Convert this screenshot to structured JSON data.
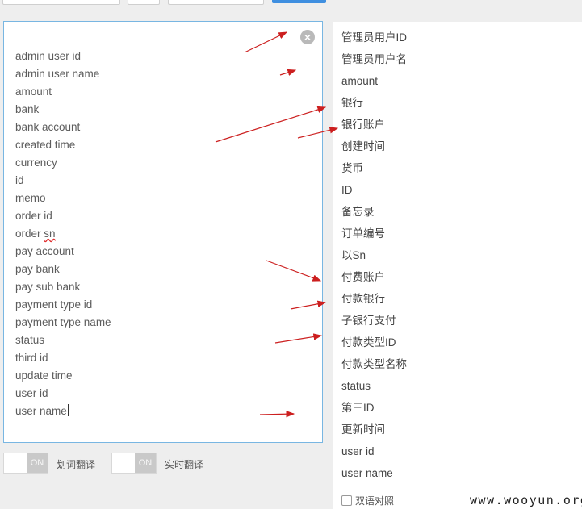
{
  "source": {
    "items": [
      "admin user id",
      "admin user name",
      "amount",
      "bank",
      "bank account",
      "created time",
      "currency",
      "id",
      "memo",
      "order id",
      "order ",
      "sn",
      "pay account",
      "pay bank",
      "pay sub bank",
      "payment type id",
      "payment type name",
      "status",
      "third id",
      "update time",
      "user id",
      "user name"
    ],
    "clear_icon": "×"
  },
  "toggles": [
    {
      "state": "ON",
      "label": "划词翻译"
    },
    {
      "state": "ON",
      "label": "实时翻译"
    }
  ],
  "results": [
    "管理员用户ID",
    "管理员用户名",
    "amount",
    "银行",
    "银行账户",
    "创建时间",
    "货币",
    "ID",
    "备忘录",
    "订单编号",
    "以Sn",
    "付费账户",
    "付款银行",
    "子银行支付",
    "付款类型ID",
    "付款类型名称",
    "status",
    "第三ID",
    "更新时间",
    "user id",
    "user name"
  ],
  "bilingual_label": "双语对照",
  "watermark": "www.wooyun.org",
  "colors": {
    "arrow": "#cc1f1f",
    "panel_border": "#78b6e2",
    "button": "#3f8fe0"
  }
}
